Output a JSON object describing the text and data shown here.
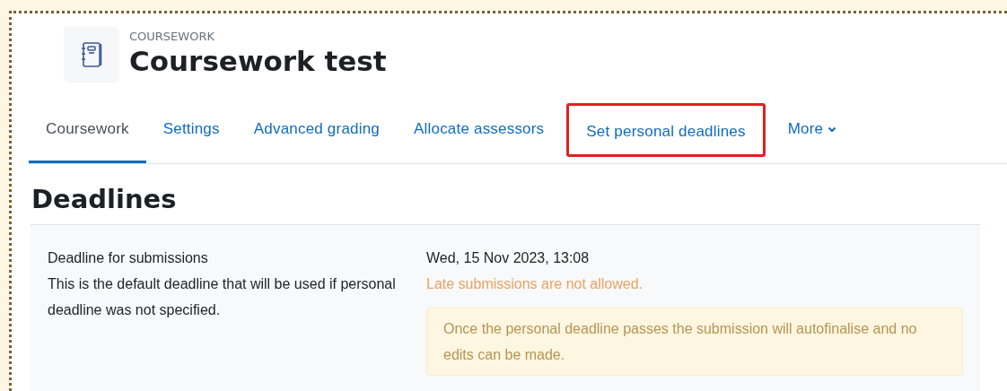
{
  "header": {
    "module_label": "COURSEWORK",
    "title": "Coursework test"
  },
  "tabs": [
    {
      "label": "Coursework",
      "selected": true,
      "highlighted": false
    },
    {
      "label": "Settings",
      "selected": false,
      "highlighted": false
    },
    {
      "label": "Advanced grading",
      "selected": false,
      "highlighted": false
    },
    {
      "label": "Allocate assessors",
      "selected": false,
      "highlighted": false
    },
    {
      "label": "Set personal deadlines",
      "selected": false,
      "highlighted": true
    },
    {
      "label": "More",
      "selected": false,
      "highlighted": false,
      "kind": "dropdown"
    }
  ],
  "section_heading": "Deadlines",
  "deadline": {
    "label": "Deadline for submissions",
    "description": "This is the default deadline that will be used if personal deadline was not specified.",
    "date": "Wed, 15 Nov 2023, 13:08",
    "late_notice": "Late submissions are not allowed.",
    "alert": "Once the personal deadline passes the submission will autofinalise and no edits can be made."
  }
}
